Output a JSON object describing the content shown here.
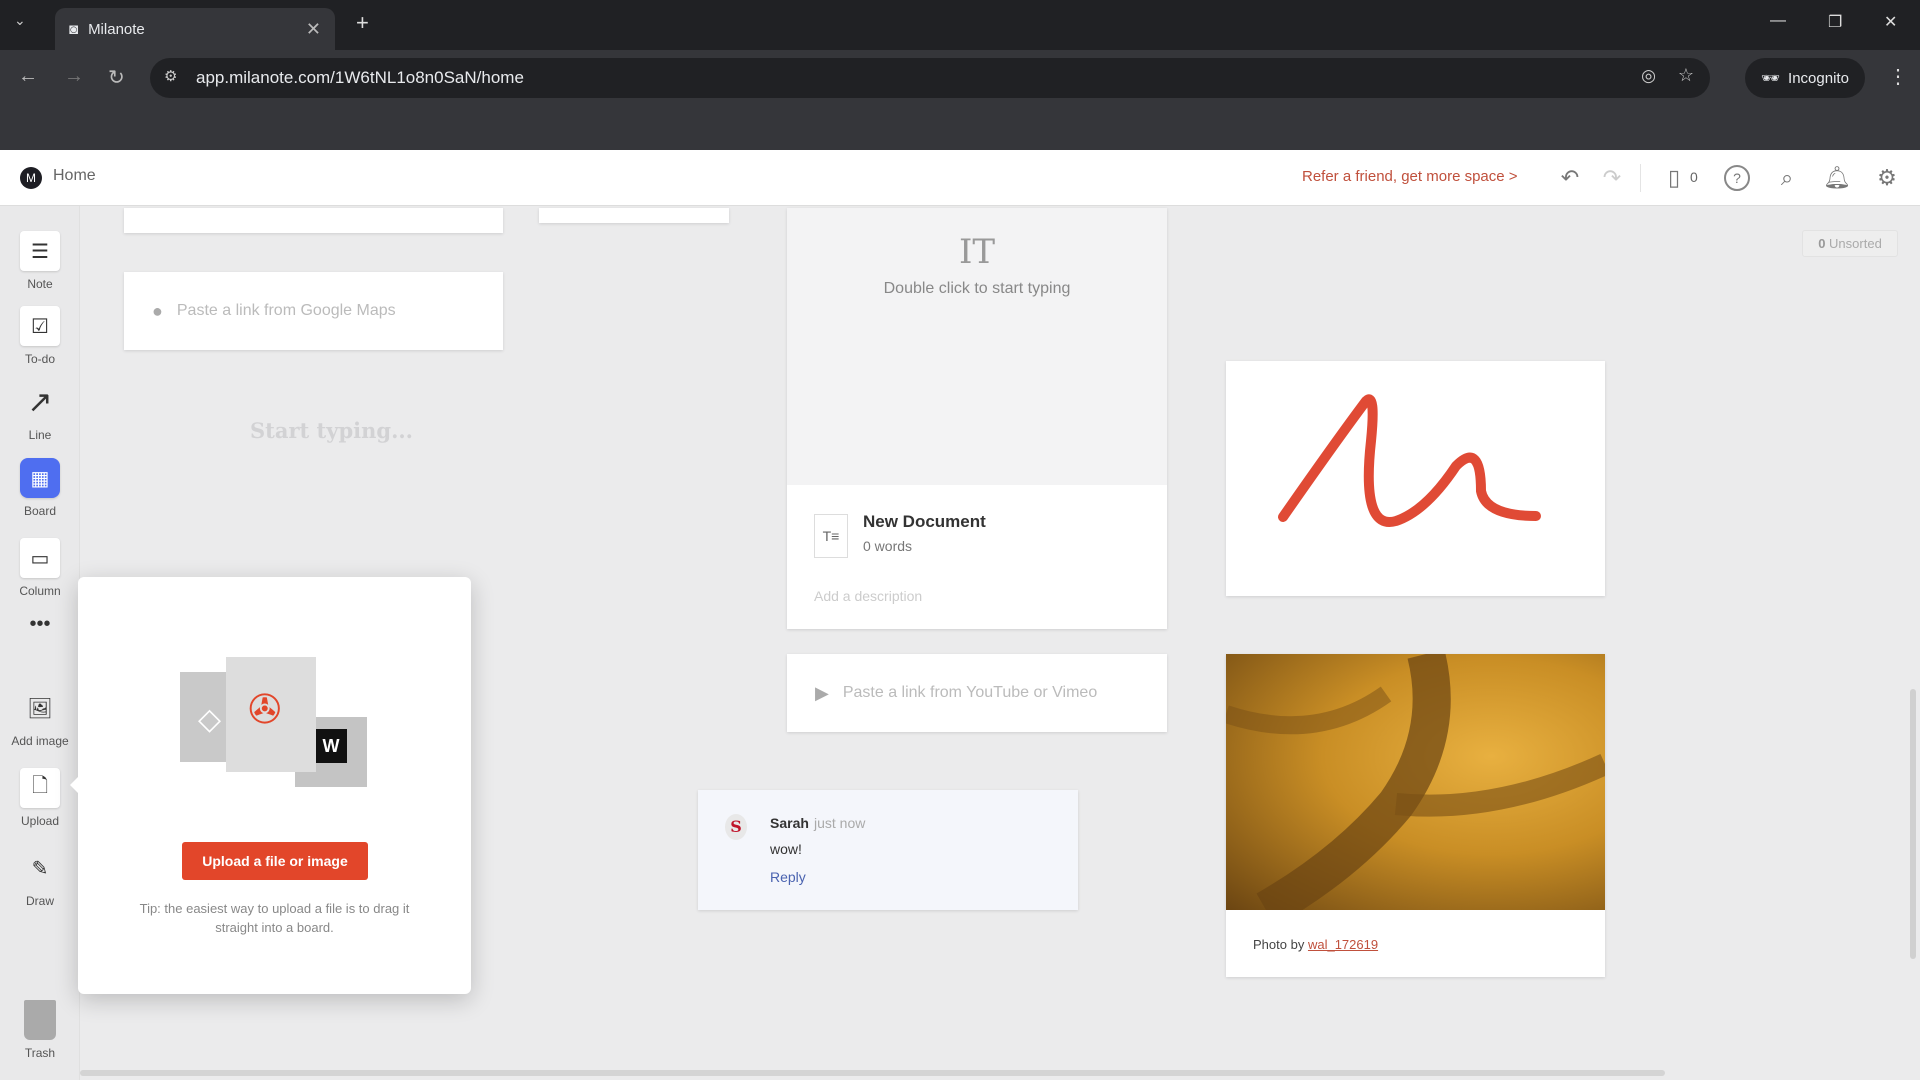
{
  "browser": {
    "tab_title": "Milanote",
    "url": "app.milanote.com/1W6tNL1o8n0SaN/home",
    "incognito_label": "Incognito"
  },
  "header": {
    "home": "Home",
    "refer": "Refer a friend, get more space >",
    "device_count": "0"
  },
  "sidebar": {
    "items": [
      {
        "label": "Note"
      },
      {
        "label": "To-do"
      },
      {
        "label": "Line"
      },
      {
        "label": "Board"
      },
      {
        "label": "Column"
      },
      {
        "label": "Add image"
      },
      {
        "label": "Upload"
      },
      {
        "label": "Draw"
      },
      {
        "label": "Trash"
      }
    ]
  },
  "canvas": {
    "maps_placeholder": "Paste a link from Google Maps",
    "start_typing": "Start typing...",
    "double_click": "Double click to start typing",
    "doc_title": "New Document",
    "doc_words": "0 words",
    "doc_description_placeholder": "Add a description",
    "video_placeholder": "Paste a link from YouTube or Vimeo",
    "comment": {
      "author": "Sarah",
      "time": "just now",
      "text": "wow!",
      "reply": "Reply"
    },
    "photo_by": "Photo by",
    "photo_author": "wal_172619",
    "unsorted_count": "0",
    "unsorted_label": "Unsorted"
  },
  "upload_popup": {
    "button": "Upload a file or image",
    "tip": "Tip: the easiest way to upload a file is to drag it straight into a board."
  },
  "colors": {
    "accent": "#e2462a",
    "board": "#4f6ef0"
  }
}
